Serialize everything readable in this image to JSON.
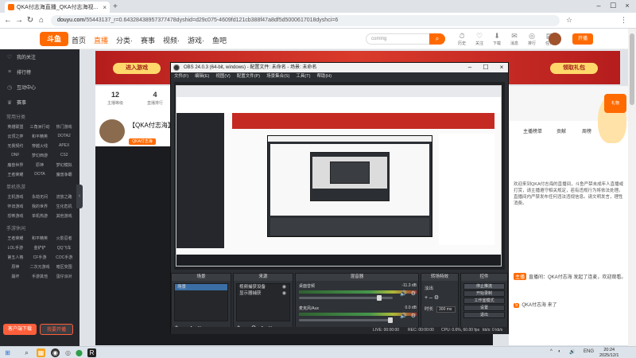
{
  "browser": {
    "tab_title": "QKA付志海直播_QKA付志海视...",
    "tab_close": "×",
    "new_tab": "+",
    "url_host": "douyu.com",
    "url_rest": "/55443137_r=0.64328438957377478dyshid=d29c075-4609fd121cb388f47a8df5d5000617018dyshci=6",
    "window_controls": [
      "–",
      "☐",
      "×"
    ],
    "nav": [
      "←",
      "→",
      "↻",
      "⌂"
    ],
    "addr_icons": [
      "☆",
      "⋮"
    ]
  },
  "site": {
    "logo": "斗鱼",
    "nav": [
      "首页",
      "直播",
      "分类·",
      "赛事",
      "视频·",
      "游戏·",
      "鱼吧"
    ],
    "active_nav": "直播",
    "search_placeholder": "coming",
    "header_icons": [
      {
        "icon": "⏱",
        "label": "历史"
      },
      {
        "icon": "♡",
        "label": "关注"
      },
      {
        "icon": "⬇",
        "label": "下载"
      },
      {
        "icon": "✉",
        "label": "消息"
      },
      {
        "icon": "◎",
        "label": "排行"
      },
      {
        "icon": "▤",
        "label": "任务"
      }
    ],
    "start_live": "开播",
    "sidebar": {
      "items": [
        {
          "icon": "♡",
          "label": "我的关注"
        },
        {
          "icon": "≡",
          "label": "排行榜"
        },
        {
          "icon": "◷",
          "label": "互动中心"
        },
        {
          "icon": "♛",
          "label": "赛事"
        }
      ],
      "sections": [
        {
          "title": "常用分类",
          "tags": [
            "英雄联盟",
            "三角洲行动",
            "热门游戏",
            "云顶之弈",
            "和平精英",
            "DOTA2",
            "无畏契约",
            "穿越火线",
            "APEX",
            "DNF",
            "梦幻西游",
            "CS2",
            "魔兽世界",
            "原神",
            "梦幻模拟",
            "王者荣耀",
            "DOTA",
            "魔兽争霸"
          ]
        },
        {
          "title": "单机热游",
          "tags": [
            "主机游戏",
            "永劫无间",
            "流放之路",
            "怀旧游戏",
            "我的世界",
            "生化危机",
            "恐怖游戏",
            "单机热游",
            "其他游戏"
          ]
        },
        {
          "title": "手游休闲",
          "tags": [
            "王者荣耀",
            "和平精英",
            "火影忍者",
            "LOL手游",
            "金铲铲",
            "QQ飞车",
            "第五人格",
            "CF手游",
            "COC手游",
            "原神",
            "二次元游戏",
            "暗区突围",
            "崩坏",
            "手游其他",
            "蛋仔派对"
          ]
        }
      ],
      "btn_primary": "客户端下载",
      "btn_secondary": "我要开播",
      "collapse": "‹"
    },
    "banner": {
      "left_btn": "进入游戏",
      "right_btn": "领取礼包"
    },
    "stats": [
      {
        "value": "12",
        "label": "主播等级"
      },
      {
        "value": "4",
        "label": "直播排行"
      }
    ],
    "room": {
      "title": "【QKA付志海】",
      "tag": "QKA付志海"
    },
    "right_panel": {
      "tabs": [
        "主播榜单",
        "贡献",
        "周榜"
      ],
      "notice": "欢迎来到QKA付志海的直播间，斗鱼严禁未成年人直播或打赏，请主播遵守相关规定，若有违规行为将依法处理。直播间内严禁发布任何违法违规信息。请文明发言，理性消费。",
      "chat": [
        {
          "badge": "主播",
          "text": "直播间：QKA付志海 发起了连麦，欢迎观看。"
        },
        {
          "badge": "5",
          "text": "QKA付志海 来了"
        }
      ],
      "gift": "礼物"
    }
  },
  "obs": {
    "title": "OBS 24.0.3 (64-bit, windows) - 配置文件: 未命名 - 场景: 未命名",
    "menu": [
      "文件(F)",
      "编辑(E)",
      "视图(V)",
      "配置文件(P)",
      "场景集合(S)",
      "工具(T)",
      "帮助(H)"
    ],
    "window_controls": [
      "–",
      "☐",
      "×"
    ],
    "docks": {
      "scenes": {
        "title": "场景",
        "items": [
          "场景"
        ]
      },
      "sources": {
        "title": "来源",
        "items": [
          "视频捕获设备",
          "显示器捕获"
        ]
      },
      "mixer": {
        "title": "混音器",
        "rows": [
          {
            "name": "桌面音频",
            "db": "-11.3 dB"
          },
          {
            "name": "麦克风/Aux",
            "db": "0.0 dB"
          }
        ]
      },
      "transitions": {
        "title": "转场特效",
        "type": "淡出",
        "duration_label": "时长",
        "duration": "300 ms"
      },
      "controls": {
        "title": "控件",
        "buttons": [
          "停止推流",
          "开始录制",
          "工作室模式",
          "设置",
          "退出"
        ]
      }
    },
    "footer_buttons": [
      "+",
      "–",
      "∧",
      "∨"
    ],
    "source_footer": [
      "+",
      "–",
      "⚙",
      "∧",
      "∨"
    ],
    "status": {
      "live": "LIVE: 00:00:00",
      "rec": "REC: 00:00:00",
      "cpu": "CPU: 0.6%, 60.00 fps",
      "kbps": "kb/s: 0 kb/s"
    }
  },
  "taskbar": {
    "start": "⊞",
    "search": "⌕",
    "apps": [
      "▦",
      "◉",
      "◎",
      "⬤",
      "R"
    ],
    "tray": [
      "^",
      "◐",
      "🔊",
      "ENG"
    ],
    "time": "20:24",
    "date": "2025/12/1"
  }
}
